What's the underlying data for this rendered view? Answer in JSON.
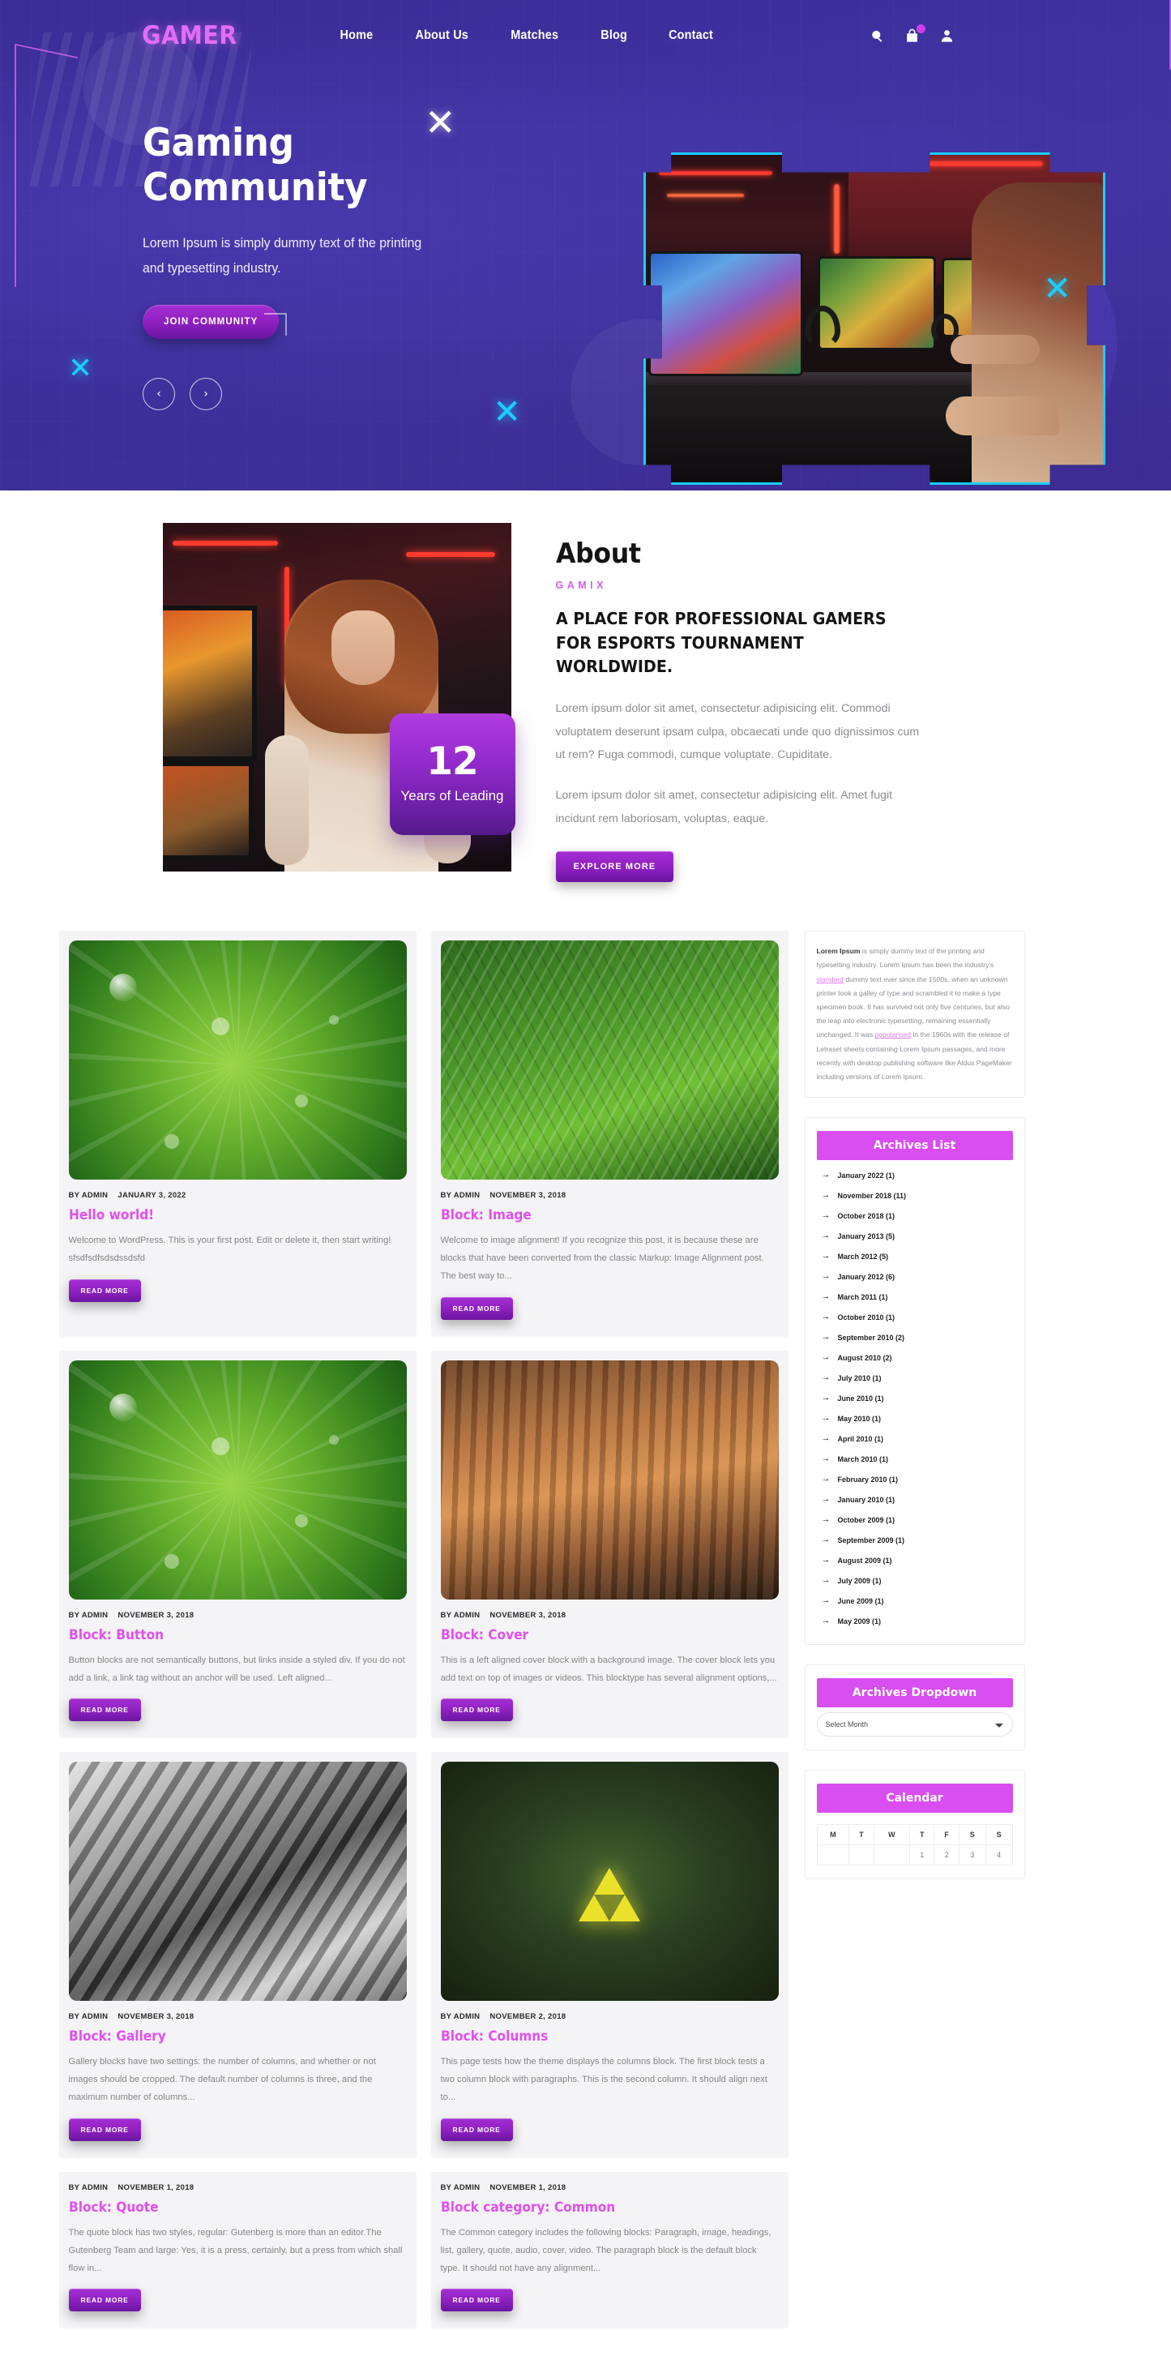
{
  "header": {
    "brand": "GAMER",
    "nav": [
      {
        "label": "Home"
      },
      {
        "label": "About Us"
      },
      {
        "label": "Matches"
      },
      {
        "label": "Blog"
      },
      {
        "label": "Contact"
      }
    ],
    "icons": [
      "search-icon",
      "cart-icon",
      "user-icon"
    ]
  },
  "hero": {
    "title_line1": "Gaming",
    "title_line2": "Community",
    "subtitle": "Lorem Ipsum is simply dummy text of the printing and typesetting industry.",
    "cta": "JOIN COMMUNITY",
    "prev": "‹",
    "next": "›",
    "deco_x": "✕"
  },
  "about": {
    "heading": "About",
    "kicker": "GAMIX",
    "subheading": "A PLACE FOR PROFESSIONAL GAMERS FOR ESPORTS TOURNAMENT WORLDWIDE.",
    "paragraph1": "Lorem ipsum dolor sit amet, consectetur adipisicing elit. Commodi voluptatem deserunt ipsam culpa, obcaecati unde quo dignissimos cum ut rem? Fuga commodi, cumque voluptate. Cupiditate.",
    "paragraph2": "Lorem ipsum dolor sit amet, consectetur adipisicing elit. Amet fugit incidunt rem laboriosam, voluptas, eaque.",
    "cta": "EXPLORE MORE",
    "badge_number": "12",
    "badge_text": "Years of Leading"
  },
  "posts": [
    {
      "thumb": "leaf",
      "author": "BY ADMIN",
      "date": "JANUARY 3, 2022",
      "title": "Hello world!",
      "excerpt": "Welcome to WordPress. This is your first post. Edit or delete it, then start writing! sfsdfsdfsdsdssdsfd",
      "read_more": "READ MORE"
    },
    {
      "thumb": "fern",
      "author": "BY ADMIN",
      "date": "NOVEMBER 3, 2018",
      "title": "Block: Image",
      "excerpt": "Welcome to image alignment! If you recognize this post, it is because these are blocks that have been converted from the classic Markup: Image Alignment post. The best way to...",
      "read_more": "READ MORE"
    },
    {
      "thumb": "leaf",
      "author": "BY ADMIN",
      "date": "NOVEMBER 3, 2018",
      "title": "Block: Button",
      "excerpt": "Button blocks are not semantically buttons, but links inside a styled div.  If you do not add a link, a link tag without an anchor will be used. Left aligned...",
      "read_more": "READ MORE"
    },
    {
      "thumb": "meat",
      "author": "BY ADMIN",
      "date": "NOVEMBER 3, 2018",
      "title": "Block: Cover",
      "excerpt": "This is a left aligned cover block with a background image. The cover block lets you add text on top of images or videos. This blocktype has several alignment options,...",
      "read_more": "READ MORE"
    },
    {
      "thumb": "bw",
      "author": "BY ADMIN",
      "date": "NOVEMBER 3, 2018",
      "title": "Block: Gallery",
      "excerpt": "Gallery blocks have two settings: the number of columns, and whether or not images should be cropped. The default number of columns is three, and the maximum number of columns...",
      "read_more": "READ MORE"
    },
    {
      "thumb": "dark",
      "author": "BY ADMIN",
      "date": "NOVEMBER 2, 2018",
      "title": "Block: Columns",
      "excerpt": "This page tests how the theme displays the columns block. The first block tests a two column block with paragraphs. This is the second column. It should align next to...",
      "read_more": "READ MORE"
    },
    {
      "thumb": "none",
      "author": "BY ADMIN",
      "date": "NOVEMBER 1, 2018",
      "title": "Block: Quote",
      "excerpt": "The quote block has two styles, regular: Gutenberg is more than an editor.The Gutenberg Team and large: Yes, it is a press, certainly, but a press from which shall flow in...",
      "read_more": "READ MORE"
    },
    {
      "thumb": "none",
      "author": "BY ADMIN",
      "date": "NOVEMBER 1, 2018",
      "title": "Block category: Common",
      "excerpt": "The Common category includes the following blocks: Paragraph, image, headings, list, gallery, quote, audio, cover, video. The paragraph block is the default block type.  It should not have any alignment...",
      "read_more": "READ MORE"
    }
  ],
  "sidebar": {
    "text_widget": {
      "lead": "Lorem Ipsum",
      "body_1": " is simply dummy text of the printing and typesetting industry. Lorem Ipsum has been the industry's ",
      "link_1": "standard",
      "body_2": " dummy text ever since the 1500s, when an unknown printer took a galley of type and scrambled it to make a type specimen book. It has survived not only five centuries, but also the leap into electronic typesetting, remaining essentially unchanged. It was ",
      "link_2": "popularised",
      "body_3": " in the 1960s with the release of Letraset sheets containing Lorem Ipsum passages, and more recently with desktop publishing software like Aldus PageMaker including versions of Lorem Ipsum."
    },
    "archives_list": {
      "title": "Archives List",
      "items": [
        "January 2022 (1)",
        "November 2018 (11)",
        "October 2018 (1)",
        "January 2013 (5)",
        "March 2012 (5)",
        "January 2012 (6)",
        "March 2011 (1)",
        "October 2010 (1)",
        "September 2010 (2)",
        "August 2010 (2)",
        "July 2010 (1)",
        "June 2010 (1)",
        "May 2010 (1)",
        "April 2010 (1)",
        "March 2010 (1)",
        "February 2010 (1)",
        "January 2010 (1)",
        "October 2009 (1)",
        "September 2009 (1)",
        "August 2009 (1)",
        "July 2009 (1)",
        "June 2009 (1)",
        "May 2009 (1)"
      ],
      "arrow": "→"
    },
    "archives_dropdown": {
      "title": "Archives Dropdown",
      "selected": "Select Month"
    },
    "calendar": {
      "title": "Calendar",
      "weekdays": [
        "M",
        "T",
        "W",
        "T",
        "F",
        "S",
        "S"
      ],
      "first_row": [
        "",
        "",
        "",
        "1",
        "2",
        "3",
        "4"
      ]
    }
  }
}
